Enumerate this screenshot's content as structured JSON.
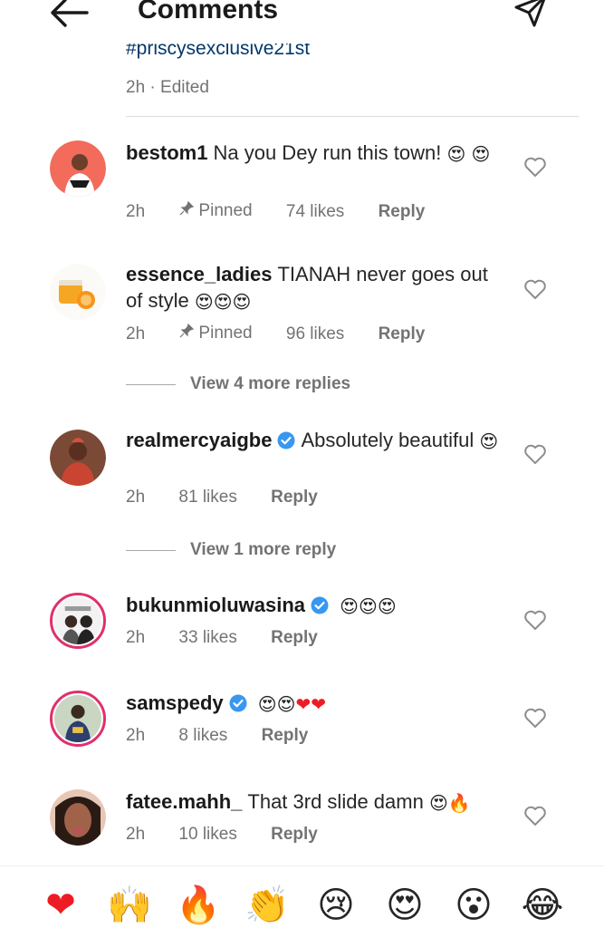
{
  "header": {
    "title": "Comments"
  },
  "caption": {
    "hashtag": "#priscysexclusive21st",
    "meta": "2h · Edited"
  },
  "comments": [
    {
      "username": "bestom1",
      "text": "Na you Dey run this town!",
      "emojis": [
        "😍",
        "😍"
      ],
      "time": "2h",
      "pinned_label": "Pinned",
      "likes": "74 likes",
      "reply": "Reply"
    },
    {
      "username": "essence_ladies",
      "text": "TIANAH never goes out of style",
      "emojis": [
        "😍",
        "😍",
        "😍"
      ],
      "time": "2h",
      "pinned_label": "Pinned",
      "likes": "96 likes",
      "reply": "Reply",
      "view_more": "View 4 more replies"
    },
    {
      "username": "realmercyaigbe",
      "verified": true,
      "text": "Absolutely beautiful",
      "emojis": [
        "😍"
      ],
      "time": "2h",
      "likes": "81 likes",
      "reply": "Reply",
      "view_more": "View 1 more reply"
    },
    {
      "username": "bukunmioluwasina",
      "verified": true,
      "text": "",
      "emojis": [
        "😍",
        "😍",
        "😍"
      ],
      "time": "2h",
      "likes": "33 likes",
      "reply": "Reply"
    },
    {
      "username": "samspedy",
      "verified": true,
      "text": "",
      "emojis": [
        "😍",
        "😍",
        "❤",
        "❤"
      ],
      "time": "2h",
      "likes": "8 likes",
      "reply": "Reply"
    },
    {
      "username": "fatee.mahh_",
      "text": "That 3rd slide damn",
      "emojis": [
        "😍",
        "🔥"
      ],
      "time": "2h",
      "likes": "10 likes",
      "reply": "Reply"
    }
  ],
  "reactions": [
    "❤",
    "🙌",
    "🔥",
    "👏",
    "😢",
    "😍",
    "😮",
    "😂"
  ],
  "colors": {
    "accent_link": "#00376b",
    "verified_blue": "#3897f0",
    "muted_text": "#737373",
    "heart_red": "#ed1c24",
    "story_ring": "#e1306c"
  }
}
